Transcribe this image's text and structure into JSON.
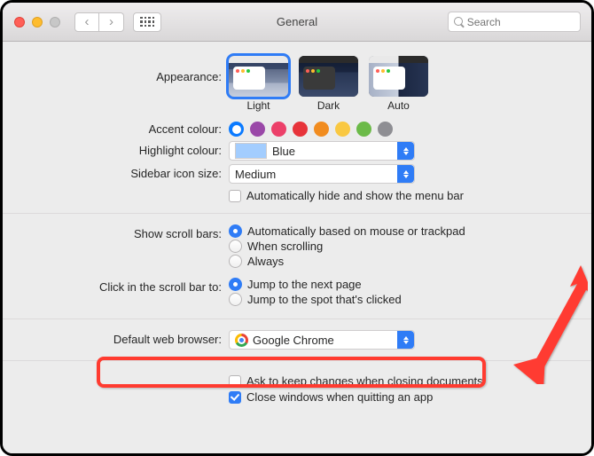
{
  "window": {
    "title": "General"
  },
  "search": {
    "placeholder": "Search"
  },
  "labels": {
    "appearance": "Appearance:",
    "accent": "Accent colour:",
    "highlight": "Highlight colour:",
    "sidebar": "Sidebar icon size:",
    "scrollbars": "Show scroll bars:",
    "clickscroll": "Click in the scroll bar to:",
    "browser": "Default web browser:"
  },
  "appearance": {
    "options": [
      "Light",
      "Dark",
      "Auto"
    ],
    "selected": "Light"
  },
  "accent": {
    "colors": [
      "#0a7aff",
      "#9a48a8",
      "#ec4069",
      "#e7333a",
      "#f18c1f",
      "#f9c842",
      "#6bba48",
      "#8e8e93"
    ],
    "selected": 0
  },
  "highlight": {
    "value": "Blue"
  },
  "sidebar_size": {
    "value": "Medium"
  },
  "auto_hide_menubar": {
    "label": "Automatically hide and show the menu bar",
    "checked": false
  },
  "scrollbars": {
    "options": [
      "Automatically based on mouse or trackpad",
      "When scrolling",
      "Always"
    ],
    "selected": 0
  },
  "clickscroll": {
    "options": [
      "Jump to the next page",
      "Jump to the spot that's clicked"
    ],
    "selected": 0
  },
  "browser": {
    "value": "Google Chrome"
  },
  "ask_keep_changes": {
    "label": "Ask to keep changes when closing documents",
    "checked": false
  },
  "close_windows_quit": {
    "label": "Close windows when quitting an app",
    "checked": true
  }
}
